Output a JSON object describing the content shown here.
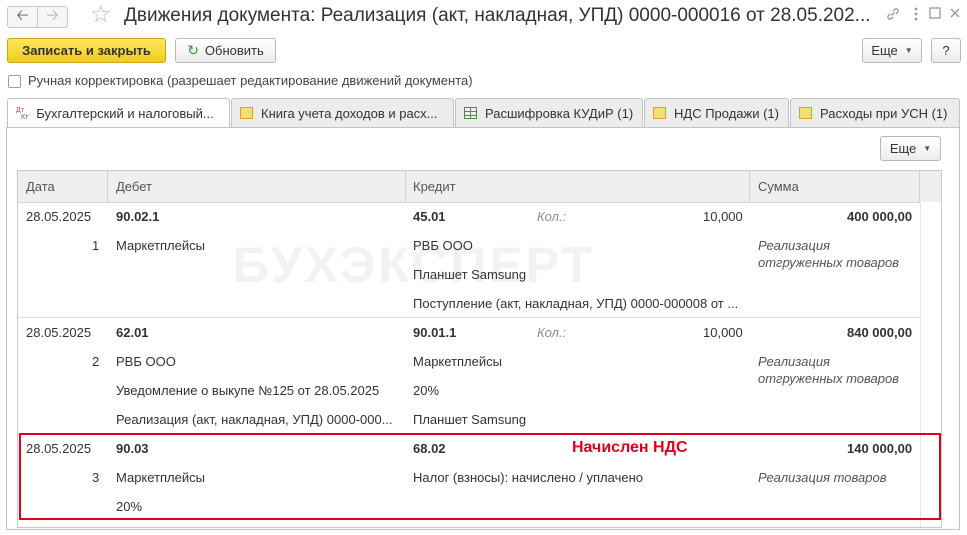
{
  "window": {
    "title": "Движения документа: Реализация (акт, накладная, УПД) 0000-000016 от 28.05.202...",
    "back_icon": "arrow-left-icon",
    "forward_icon": "arrow-right-icon",
    "favorite_icon": "star-icon",
    "link_icon": "link-icon",
    "menu_icon": "more-vertical-icon",
    "maximize_icon": "maximize-icon",
    "close_icon": "close-icon"
  },
  "toolbar": {
    "save_close_label": "Записать и закрыть",
    "refresh_label": "Обновить",
    "more_label": "Еще",
    "help_label": "?"
  },
  "manual_adjust": {
    "checked": false,
    "label": "Ручная корректировка (разрешает редактирование движений документа)"
  },
  "tabs": [
    {
      "label": "Бухгалтерский и налоговый...",
      "icon": "dt-kt-icon",
      "active": true
    },
    {
      "label": "Книга учета доходов и расх...",
      "icon": "register-icon",
      "active": false
    },
    {
      "label": "Расшифровка КУДиР (1)",
      "icon": "table-icon",
      "active": false
    },
    {
      "label": "НДС Продажи (1)",
      "icon": "register-icon",
      "active": false
    },
    {
      "label": "Расходы при УСН (1)",
      "icon": "register-icon",
      "active": false
    }
  ],
  "grid_more_label": "Еще",
  "watermark_text": "БУХЭКСПЕРТ",
  "columns": {
    "date": "Дата",
    "debit": "Дебет",
    "credit": "Кредит",
    "sum": "Сумма"
  },
  "rows": [
    {
      "date": "28.05.2025",
      "n": "1",
      "debit_account": "90.02.1",
      "debit_sub": [
        "Маркетплейсы",
        "",
        ""
      ],
      "credit_account": "45.01",
      "qty_label": "Кол.:",
      "qty": "10,000",
      "credit_sub": [
        "РВБ ООО",
        "Планшет Samsung",
        "Поступление (акт, накладная, УПД) 0000-000008 от ..."
      ],
      "sum": "400 000,00",
      "content": [
        "Реализация",
        "отгруженных товаров"
      ]
    },
    {
      "date": "28.05.2025",
      "n": "2",
      "debit_account": "62.01",
      "debit_sub": [
        "РВБ ООО",
        "Уведомление о выкупе №125 от 28.05.2025",
        "Реализация (акт, накладная, УПД) 0000-000..."
      ],
      "credit_account": "90.01.1",
      "qty_label": "Кол.:",
      "qty": "10,000",
      "credit_sub": [
        "Маркетплейсы",
        "20%",
        "Планшет Samsung"
      ],
      "sum": "840 000,00",
      "content": [
        "Реализация",
        "отгруженных товаров"
      ]
    },
    {
      "date": "28.05.2025",
      "n": "3",
      "debit_account": "90.03",
      "debit_sub": [
        "Маркетплейсы",
        "20%",
        ""
      ],
      "credit_account": "68.02",
      "credit_sub": [
        "Налог (взносы): начислено / уплачено",
        "",
        ""
      ],
      "sum": "140 000,00",
      "content": [
        "Реализация товаров",
        ""
      ],
      "annotation": "Начислен НДС"
    }
  ],
  "colors": {
    "primary_button": "#f4d12c",
    "highlight_border": "#e3001b",
    "annotation_text": "#e3001b"
  }
}
